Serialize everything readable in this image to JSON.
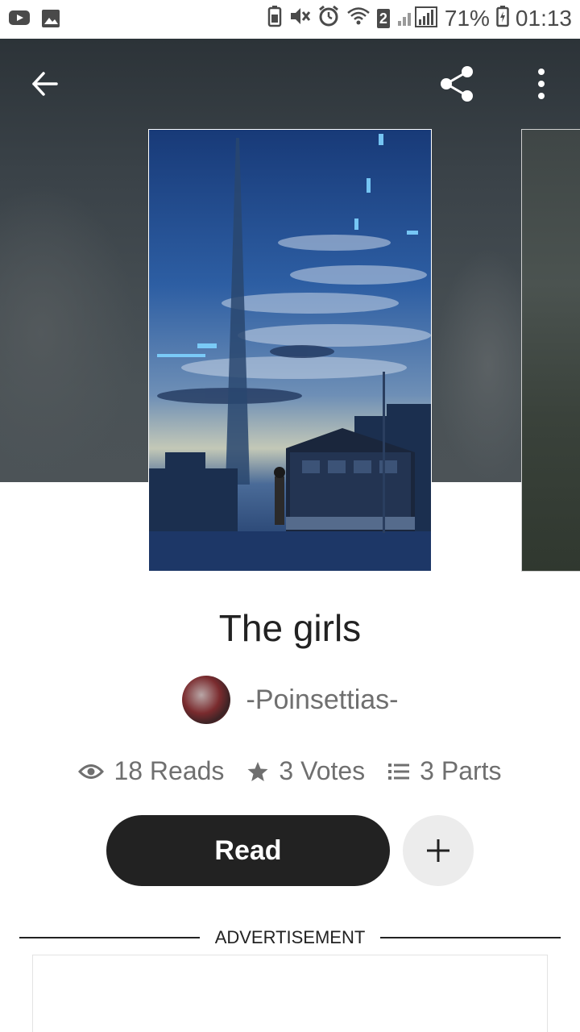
{
  "status_bar": {
    "battery_percent": "71%",
    "time": "01:13",
    "sim_badge": "2",
    "icons": [
      "youtube-icon",
      "image-icon",
      "battery-saver-icon",
      "mute-icon",
      "alarm-icon",
      "wifi-icon",
      "signal-icon",
      "battery-icon"
    ]
  },
  "toolbar": {
    "back_icon": "arrow-left-icon",
    "share_icon": "share-icon",
    "more_icon": "more-vertical-icon"
  },
  "story": {
    "title": "The girls",
    "author": "-Poinsettias-",
    "stats": {
      "reads": "18 Reads",
      "votes": "3 Votes",
      "parts": "3 Parts"
    }
  },
  "actions": {
    "read_label": "Read",
    "add_icon": "plus-icon"
  },
  "advertisement": {
    "label": "ADVERTISEMENT"
  },
  "colors": {
    "primary_button": "#222222",
    "secondary_button": "#ececec",
    "muted_text": "#6f6f6f",
    "hero_background": "#3a4248"
  }
}
